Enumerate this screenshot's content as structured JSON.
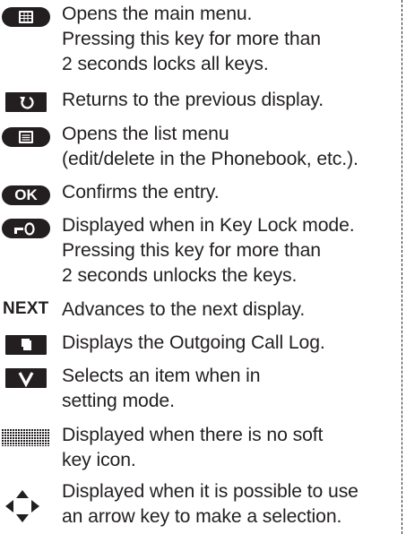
{
  "entries": [
    {
      "icon": "main-menu-key-icon",
      "lines": [
        "Opens the main menu.",
        "Pressing this key for more than",
        "2 seconds locks all keys."
      ]
    },
    {
      "icon": "back-key-icon",
      "lines": [
        "Returns to the previous display."
      ]
    },
    {
      "icon": "list-menu-key-icon",
      "lines": [
        "Opens the list menu",
        "(edit/delete in the Phonebook, etc.)."
      ]
    },
    {
      "icon": "ok-key-icon",
      "label": "OK",
      "lines": [
        "Confirms the entry."
      ]
    },
    {
      "icon": "key-lock-icon",
      "lines": [
        "Displayed when in Key Lock mode.",
        "Pressing this key for more than",
        "2 seconds unlocks the keys."
      ]
    },
    {
      "icon": "next-key-icon",
      "label": "NEXT",
      "lines": [
        "Advances to the next display."
      ]
    },
    {
      "icon": "outgoing-call-log-key-icon",
      "lines": [
        "Displays the Outgoing Call Log."
      ]
    },
    {
      "icon": "select-check-key-icon",
      "lines": [
        "Selects an item when in",
        "setting mode."
      ]
    },
    {
      "icon": "no-soft-key-icon",
      "lines": [
        "Displayed when there is no soft",
        "key icon."
      ]
    },
    {
      "icon": "arrow-key-icon",
      "lines": [
        "Displayed when it is possible to use",
        "an arrow key to make a selection."
      ]
    }
  ]
}
